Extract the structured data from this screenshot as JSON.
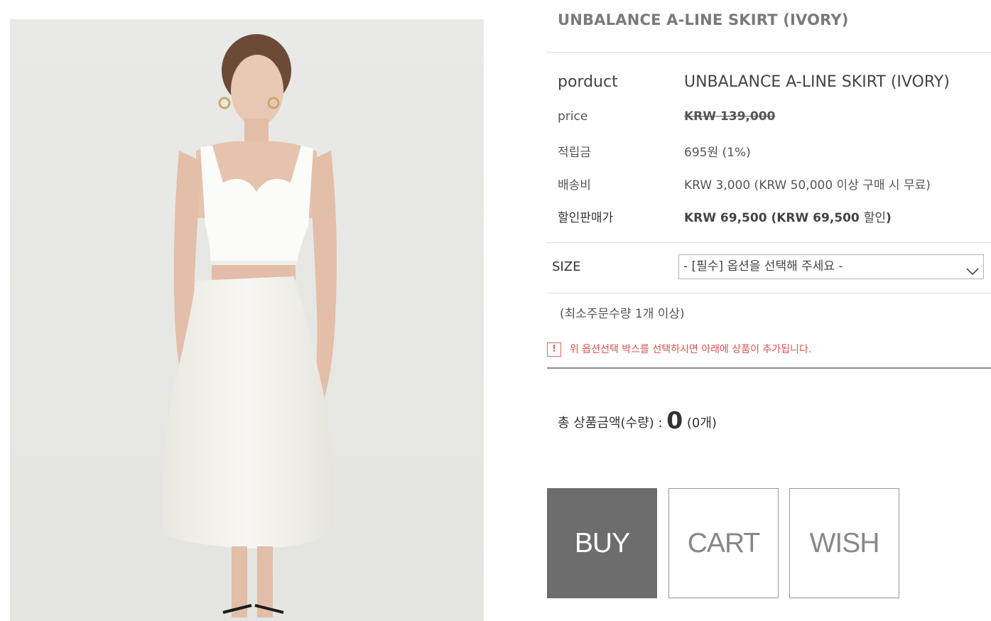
{
  "product": {
    "title": "UNBALANCE A-LINE SKIRT (IVORY)",
    "image_label": "model-wearing-ivory-skirt"
  },
  "details": {
    "product_label": "porduct",
    "product_value": "UNBALANCE A-LINE SKIRT (IVORY)",
    "price_label": "price",
    "price_value": "KRW 139,000",
    "points_label": "적립금",
    "points_value": "695원 (1%)",
    "shipping_label": "배송비",
    "shipping_value": "KRW 3,000 (KRW 50,000 이상 구매 시 무료)",
    "sale_label": "할인판매가",
    "sale_value_main": "KRW 69,500 (KRW 69,500 ",
    "sale_value_suffix": "할인",
    "sale_value_close": ")"
  },
  "option": {
    "size_label": "SIZE",
    "selected": "- [필수] 옵션을 선택해 주세요 -"
  },
  "min_order": "(최소주문수량 1개 이상)",
  "notice": {
    "badge": "!",
    "text": "위 옵션선택 박스를 선택하시면 아래에 상품이 추가됩니다."
  },
  "total": {
    "label": "총 상품금액(수량) : ",
    "amount": "0",
    "qty": " (0개)"
  },
  "buttons": {
    "buy": "BUY",
    "cart": "CART",
    "wish": "WISH"
  },
  "colors": {
    "buy_bg": "#6d6d6d",
    "notice": "#d9534f",
    "title": "#7a7a7a"
  }
}
